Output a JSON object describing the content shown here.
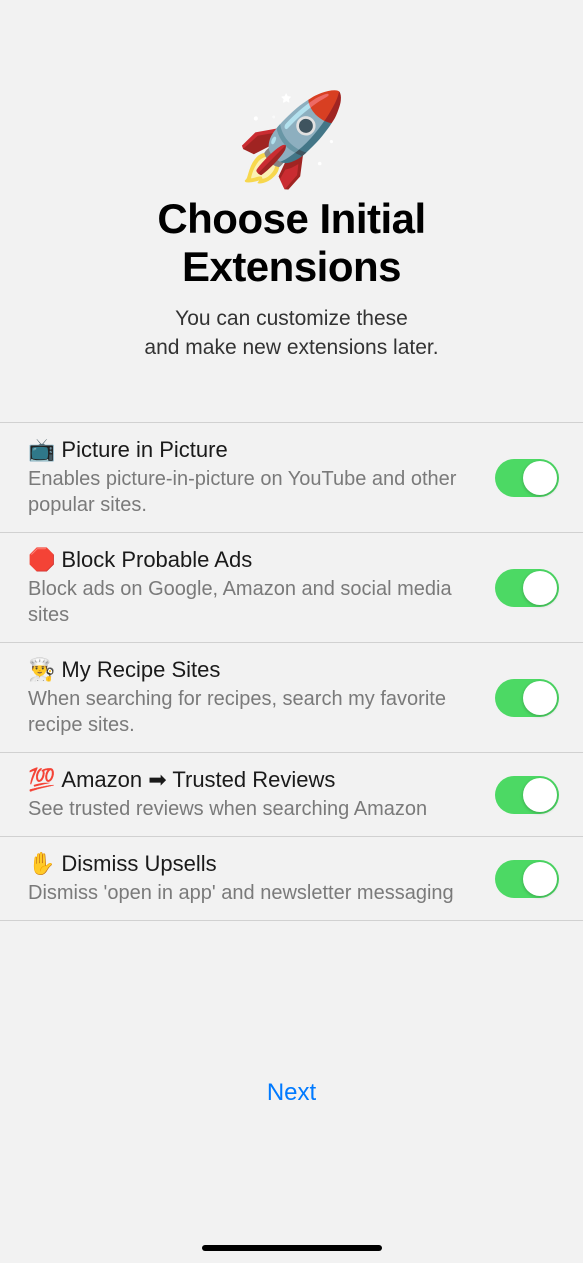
{
  "hero": {
    "icon": "🚀",
    "title_line1": "Choose Initial",
    "title_line2": "Extensions",
    "subtitle_line1": "You can customize these",
    "subtitle_line2": "and make new extensions later."
  },
  "extensions": [
    {
      "emoji": "📺",
      "title": "Picture in Picture",
      "desc": "Enables picture-in-picture on YouTube and other popular sites.",
      "enabled": true
    },
    {
      "emoji": "🛑",
      "title": "Block Probable Ads",
      "desc": "Block ads on Google, Amazon and social media sites",
      "enabled": true
    },
    {
      "emoji": "👨‍🍳",
      "title": "My Recipe Sites",
      "desc": "When searching for recipes, search my favorite recipe sites.",
      "enabled": true
    },
    {
      "emoji": "💯",
      "title": "Amazon ➡ Trusted Reviews",
      "desc": "See trusted reviews when searching Amazon",
      "enabled": true
    },
    {
      "emoji": "✋",
      "title": "Dismiss Upsells",
      "desc": "Dismiss 'open in app' and newsletter messaging",
      "enabled": true
    }
  ],
  "footer": {
    "next_label": "Next"
  }
}
